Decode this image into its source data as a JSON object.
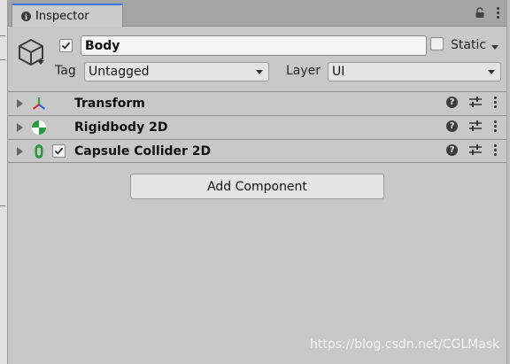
{
  "window": {
    "tab_label": "Inspector",
    "tab_icon": "info-icon",
    "tab_accent_color": "#3a79d6"
  },
  "gameobject": {
    "active": true,
    "name": "Body",
    "static_label": "Static",
    "static_checked": false,
    "tag_label": "Tag",
    "tag_value": "Untagged",
    "layer_label": "Layer",
    "layer_value": "UI"
  },
  "components": [
    {
      "name": "Transform",
      "icon": "transform-icon",
      "has_toggle": false
    },
    {
      "name": "Rigidbody 2D",
      "icon": "rigidbody-icon",
      "has_toggle": false
    },
    {
      "name": "Capsule Collider 2D",
      "icon": "capsule-collider-icon",
      "has_toggle": true,
      "enabled": true
    }
  ],
  "add_component_label": "Add Component",
  "watermark": "https://blog.csdn.net/CGLMask"
}
